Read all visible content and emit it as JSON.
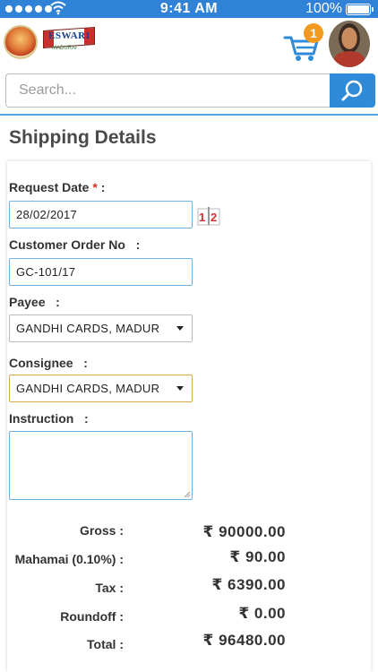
{
  "status_bar": {
    "time": "9:41 AM",
    "battery": "100%"
  },
  "header": {
    "cart_count": "1"
  },
  "search": {
    "placeholder": "Search..."
  },
  "page": {
    "title": "Shipping Details"
  },
  "form": {
    "request_date": {
      "label": "Request Date",
      "required_mark": "*",
      "colon": ":",
      "value": "28/02/2017"
    },
    "customer_order": {
      "label": "Customer Order No",
      "colon": ":",
      "value": "GC-101/17"
    },
    "payee": {
      "label": "Payee",
      "colon": ":",
      "value": "GANDHI CARDS, MADUR"
    },
    "consignee": {
      "label": "Consignee",
      "colon": ":",
      "value": "GANDHI CARDS, MADUR"
    },
    "instruction": {
      "label": "Instruction",
      "colon": ":",
      "value": ""
    }
  },
  "summary": [
    {
      "label": "Gross  :",
      "value": "₹ 90000.00"
    },
    {
      "label": "Mahamai (0.10%) :",
      "value": "₹ 90.00"
    },
    {
      "label": "Tax :",
      "value": "₹ 6390.00"
    },
    {
      "label": "Roundoff :",
      "value": "₹ 0.00"
    },
    {
      "label": "Total :",
      "value": "₹ 96480.00"
    }
  ],
  "colors": {
    "primary": "#2f82d6",
    "badge": "#f39a1e",
    "required": "#e0302a",
    "focus_border": "#d9a94c"
  }
}
